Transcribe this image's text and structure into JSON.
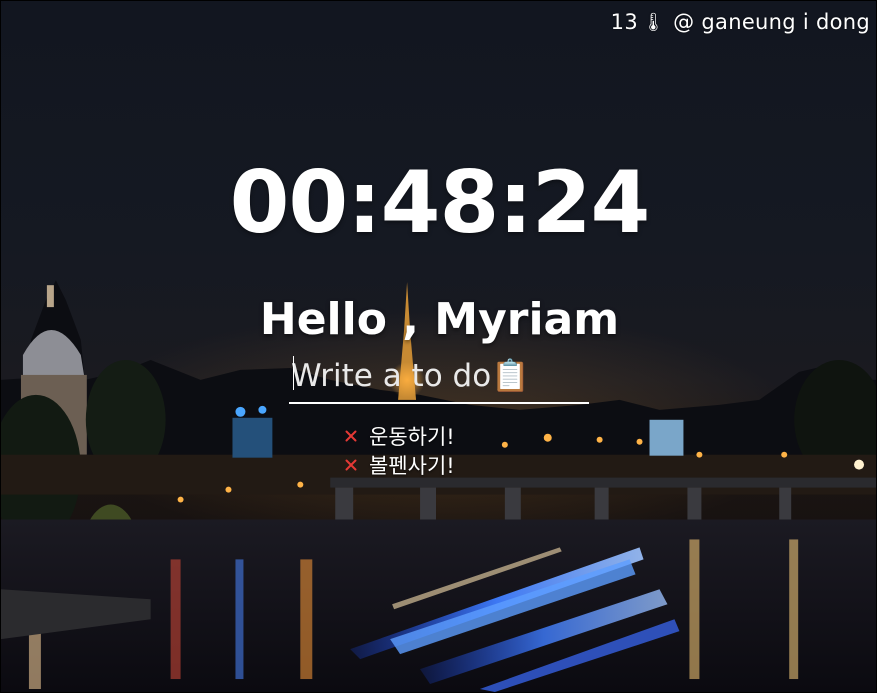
{
  "weather": {
    "temperature": "13",
    "temperature_icon": "thermometer-icon",
    "location": "@ ganeung i dong"
  },
  "clock": {
    "time": "00:48:24"
  },
  "greeting": {
    "text": "Hello , Myriam"
  },
  "todo": {
    "placeholder": "Write a to do📋",
    "items": [
      {
        "text": "운동하기!",
        "delete_icon": "close-icon"
      },
      {
        "text": "볼펜사기!",
        "delete_icon": "close-icon"
      }
    ]
  },
  "colors": {
    "text": "#ffffff",
    "delete_icon": "#e53935"
  },
  "background": {
    "description_icon": "paris-night-river-background"
  }
}
